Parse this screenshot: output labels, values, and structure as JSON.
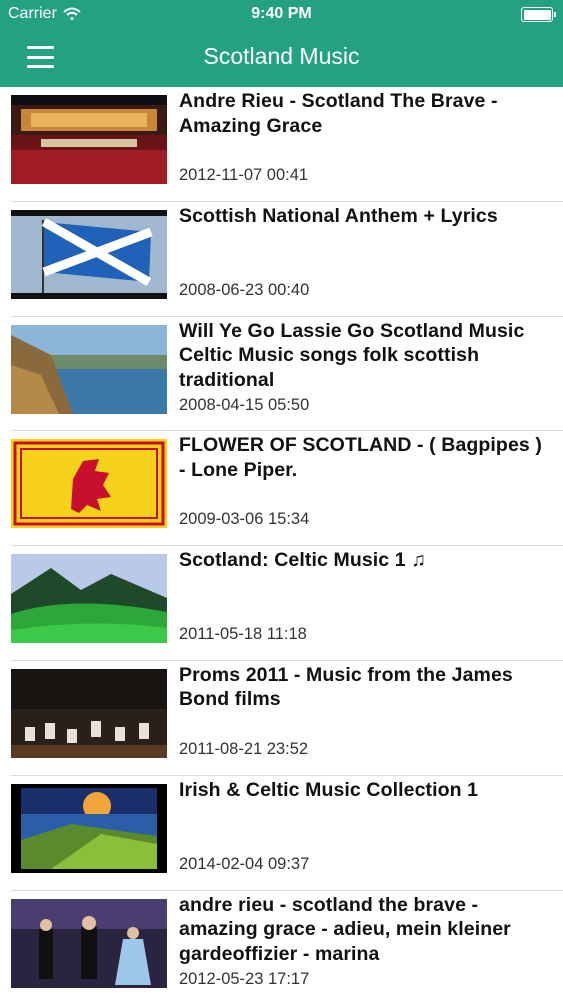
{
  "status_bar": {
    "carrier": "Carrier",
    "time": "9:40 PM"
  },
  "nav": {
    "title": "Scotland Music"
  },
  "videos": [
    {
      "title": "Andre Rieu - Scotland The Brave - Amazing Grace",
      "date": "2012-11-07 00:41"
    },
    {
      "title": "Scottish National Anthem + Lyrics",
      "date": "2008-06-23 00:40"
    },
    {
      "title": "Will Ye Go Lassie Go  Scotland Music Celtic Music songs folk scottish traditional",
      "date": "2008-04-15 05:50"
    },
    {
      "title": "FLOWER OF SCOTLAND - ( Bagpipes ) - Lone Piper.",
      "date": "2009-03-06 15:34"
    },
    {
      "title": "Scotland:  Celtic Music 1 ♫",
      "date": "2011-05-18 11:18"
    },
    {
      "title": "Proms 2011 - Music from the James Bond films",
      "date": "2011-08-21 23:52"
    },
    {
      "title": "Irish & Celtic Music Collection 1",
      "date": "2014-02-04 09:37"
    },
    {
      "title": "andre rieu - scotland the brave - amazing grace - adieu, mein kleiner gardeoffizier - marina",
      "date": "2012-05-23 17:17"
    }
  ]
}
